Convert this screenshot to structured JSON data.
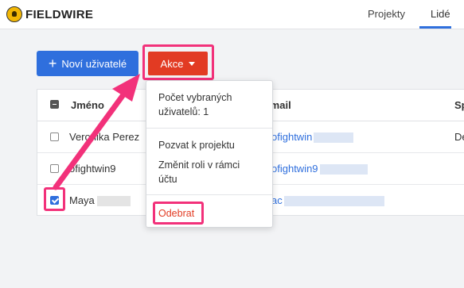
{
  "brand": {
    "name": "FIELDWIRE",
    "logo_icon": "fieldwire-helmet-icon"
  },
  "topnav": {
    "tabs": [
      {
        "label": "Projekty",
        "active": false
      },
      {
        "label": "Lidé",
        "active": true
      }
    ]
  },
  "toolbar": {
    "new_users_label": "Noví uživatelé",
    "actions_label": "Akce"
  },
  "table": {
    "headers": [
      "Jméno",
      "Email",
      "Sp"
    ],
    "rows": [
      {
        "name": "Veronika Perez",
        "email": "ofightwin",
        "extra": "De",
        "checked": false
      },
      {
        "name": "ofightwin9",
        "email": "ofightwin9",
        "extra": "",
        "checked": false
      },
      {
        "name": "Maya",
        "email": "ac",
        "extra": "",
        "checked": true
      }
    ]
  },
  "dropdown": {
    "selected_count": "Počet vybraných uživatelů: 1",
    "items": [
      "Pozvat k projektu",
      "Změnit roli v rámci účtu"
    ],
    "remove": "Odebrat"
  },
  "colors": {
    "accent_blue": "#2f6fdd",
    "action_red": "#e23b23",
    "highlight_pink": "#f2317a"
  }
}
